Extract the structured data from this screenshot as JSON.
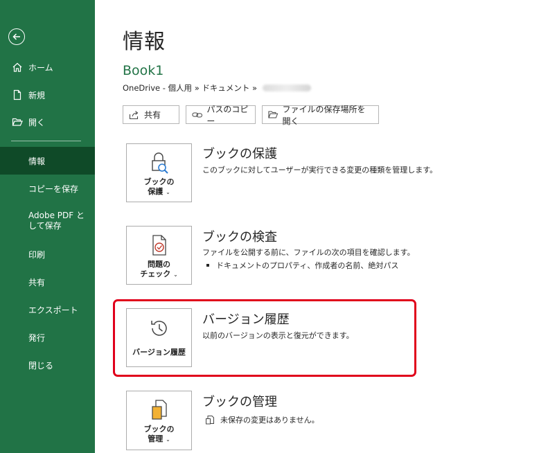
{
  "sidebar": {
    "items": [
      {
        "label": "ホーム"
      },
      {
        "label": "新規"
      },
      {
        "label": "開く"
      },
      {
        "label": "情報"
      },
      {
        "label": "コピーを保存"
      },
      {
        "label": "Adobe PDF として保存"
      },
      {
        "label": "印刷"
      },
      {
        "label": "共有"
      },
      {
        "label": "エクスポート"
      },
      {
        "label": "発行"
      },
      {
        "label": "閉じる"
      }
    ],
    "active": "情報",
    "bg_color": "#217346",
    "active_color": "#0f4a28"
  },
  "main": {
    "title": "情報",
    "doc_name": "Book1",
    "doc_path": "OneDrive - 個人用 » ドキュメント »",
    "buttons": [
      {
        "label": "共有",
        "icon": "share-icon"
      },
      {
        "label": "パスのコピー",
        "icon": "link-icon"
      },
      {
        "label": "ファイルの保存場所を開く",
        "icon": "folder-icon"
      }
    ],
    "sections": [
      {
        "tile_label_1": "ブックの",
        "tile_label_2": "保護",
        "title": "ブックの保護",
        "desc": "このブックに対してユーザーが実行できる変更の種類を管理します。",
        "icon": "lock-search-icon"
      },
      {
        "tile_label_1": "問題の",
        "tile_label_2": "チェック",
        "title": "ブックの検査",
        "desc": "ファイルを公開する前に、ファイルの次の項目を確認します。",
        "bullet": "ドキュメントのプロパティ、作成者の名前、絶対パス",
        "icon": "inspect-document-icon"
      },
      {
        "tile_label_1": "バージョン履歴",
        "title": "バージョン履歴",
        "desc": "以前のバージョンの表示と復元ができます。",
        "icon": "history-clock-icon"
      },
      {
        "tile_label_1": "ブックの",
        "tile_label_2": "管理",
        "title": "ブックの管理",
        "desc": "未保存の変更はありません。",
        "icon": "manage-workbook-icon"
      }
    ],
    "accent_color": "#217346",
    "highlight_color": "#e0001b"
  }
}
